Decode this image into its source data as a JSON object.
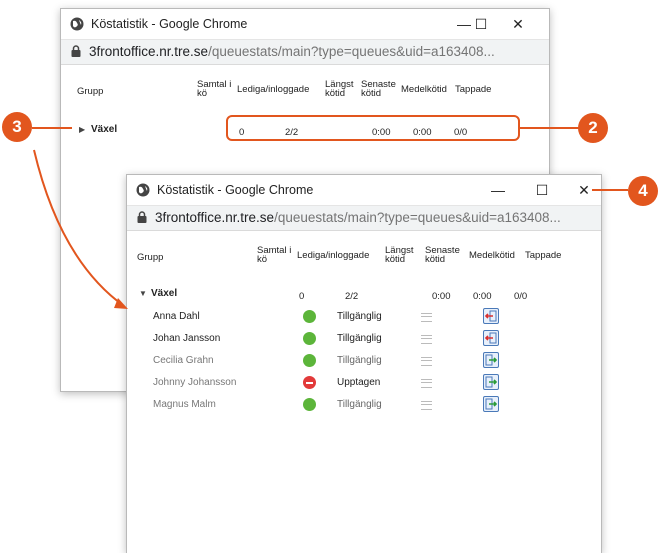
{
  "window1": {
    "title": "Köstatistik - Google Chrome",
    "url_host": "3frontoffice.nr.tre.se",
    "url_path": "/queuestats/main?type=queues&uid=a163408...",
    "columns": {
      "grupp": "Grupp",
      "samtal_line1": "Samtal i",
      "samtal_line2": "kö",
      "lediga": "Lediga/inloggade",
      "langst_line1": "Längst",
      "langst_line2": "kötid",
      "senaste_line1": "Senaste",
      "senaste_line2": "kötid",
      "medel": "Medelkötid",
      "tappade": "Tappade"
    },
    "group": {
      "name": "Växel",
      "samtal": "0",
      "lediga": "2/2",
      "senaste": "0:00",
      "medel": "0:00",
      "tappade": "0/0"
    }
  },
  "window2": {
    "title": "Köstatistik - Google Chrome",
    "url_host": "3frontoffice.nr.tre.se",
    "url_path": "/queuestats/main?type=queues&uid=a163408...",
    "columns": {
      "grupp": "Grupp",
      "samtal_line1": "Samtal i",
      "samtal_line2": "kö",
      "lediga": "Lediga/inloggade",
      "langst_line1": "Längst",
      "langst_line2": "kötid",
      "senaste_line1": "Senaste",
      "senaste_line2": "kötid",
      "medel": "Medelkötid",
      "tappade": "Tappade"
    },
    "group": {
      "name": "Växel",
      "samtal": "0",
      "lediga": "2/2",
      "senaste": "0:00",
      "medel": "0:00",
      "tappade": "0/0"
    },
    "agents": [
      {
        "name": "Anna Dahl",
        "status": "Tillgänglig"
      },
      {
        "name": "Johan Jansson",
        "status": "Tillgänglig"
      },
      {
        "name": "Cecilia Grahn",
        "status": "Tillgänglig"
      },
      {
        "name": "Johnny Johansson",
        "status": "Upptagen"
      },
      {
        "name": "Magnus Malm",
        "status": "Tillgänglig"
      }
    ]
  },
  "window_controls": {
    "minimize": "—",
    "maximize": "☐",
    "close": "✕"
  },
  "callouts": {
    "c2": "2",
    "c3": "3",
    "c4": "4"
  },
  "colors": {
    "accent": "#e2561e",
    "available": "#5cb53a",
    "busy": "#e23a3a"
  }
}
